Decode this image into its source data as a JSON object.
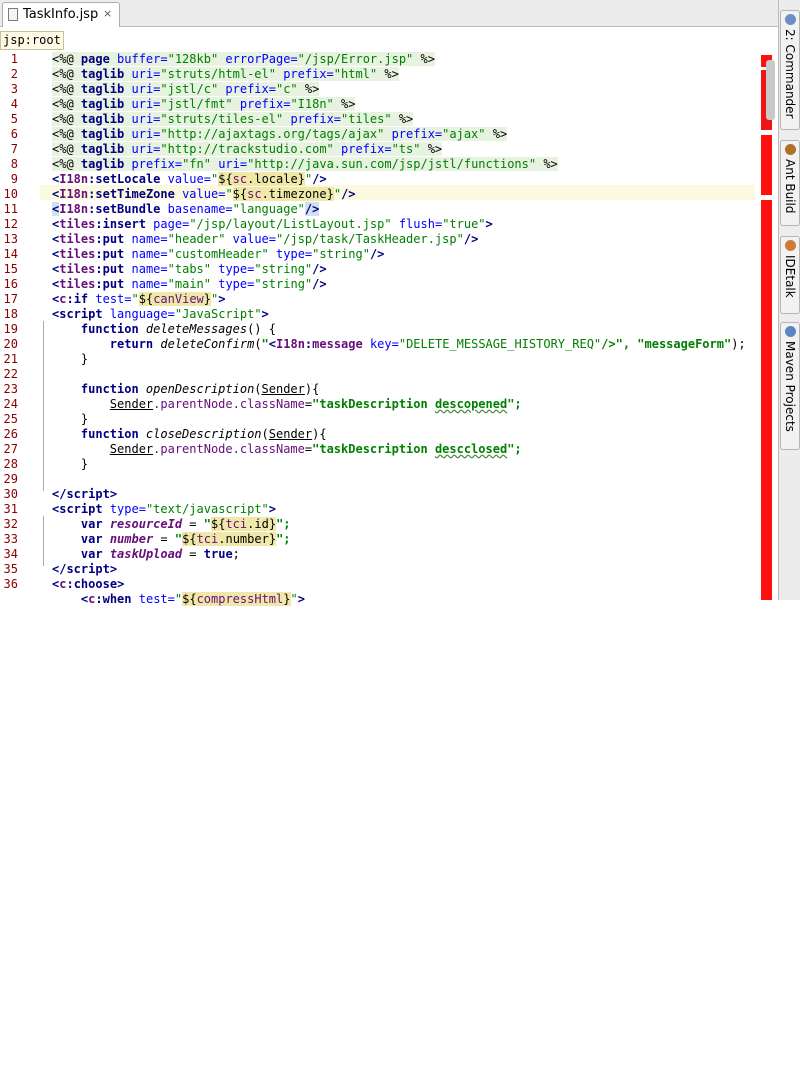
{
  "tab": {
    "title": "TaskInfo.jsp",
    "file_icon": "jsp-file-icon",
    "close_glyph": "×"
  },
  "breadcrumb": "jsp:root",
  "right_tools": [
    {
      "label": "2: Commander",
      "icon": "commander-icon"
    },
    {
      "label": "Ant Build",
      "icon": "ant-icon"
    },
    {
      "label": "IDEtalk",
      "icon": "idetalk-icon"
    },
    {
      "label": "Maven Projects",
      "icon": "maven-icon"
    }
  ],
  "line_numbers": [
    "1",
    "2",
    "3",
    "4",
    "5",
    "6",
    "7",
    "8",
    "9",
    "10",
    "11",
    "12",
    "13",
    "14",
    "15",
    "16",
    "17",
    "18",
    "19",
    "20",
    "21",
    "22",
    "23",
    "24",
    "25",
    "26",
    "27",
    "28",
    "29",
    "30",
    "31",
    "32",
    "33",
    "34",
    "35",
    "36"
  ],
  "tok": {
    "pd": "<%@ ",
    "page": "page",
    "taglib": "taglib",
    "pe": " %>",
    "buffer": " buffer=",
    "v128": "\"128kb\"",
    "errorPage": " errorPage=",
    "vError": "\"/jsp/Error.jsp\"",
    "uri": " uri=",
    "prefix": " prefix=",
    "v_struts_html": "\"struts/html-el\"",
    "v_html": "\"html\"",
    "v_jstl_c": "\"jstl/c\"",
    "v_c": "\"c\"",
    "v_jstl_fmt": "\"jstl/fmt\"",
    "v_i18n": "\"I18n\"",
    "v_struts_tiles": "\"struts/tiles-el\"",
    "v_tiles": "\"tiles\"",
    "v_ajax_url": "\"http://ajaxtags.org/tags/ajax\"",
    "v_ajax": "\"ajax\"",
    "v_ts_url": "\"http://trackstudio.com\"",
    "v_ts": "\"ts\"",
    "prefix_fn": "prefix=",
    "v_fn": "\"fn\"",
    "v_fn_url": "\"http://java.sun.com/jsp/jstl/functions\"",
    "lt": "<",
    "close": "/>",
    "gt": ">",
    "endopen": "</",
    "I18n": "I18n",
    "colon": ":",
    "setLocale": "setLocale",
    "setTimeZone": "setTimeZone",
    "setBundle": "setBundle",
    "value": " value=",
    "q_open": "\"",
    "el_open": "${",
    "sc": "sc",
    "dot_locale": ".locale",
    "dot_timezone": ".timezone",
    "el_close": "}",
    "q_close": "\"",
    "basename": " basename=",
    "v_language": "\"language\"",
    "tiles": "tiles",
    "insert": "insert",
    "put": "put",
    "page_attr": " page=",
    "v_listlayout": "\"/jsp/layout/ListLayout.jsp\"",
    "flush": " flush=",
    "v_true": "\"true\"",
    "name": " name=",
    "v_header": "\"header\"",
    "v_taskheader": "\"/jsp/task/TaskHeader.jsp\"",
    "v_customHeader": "\"customHeader\"",
    "type": " type=",
    "v_string": "\"string\"",
    "v_tabs": "\"tabs\"",
    "v_main": "\"main\"",
    "c": "c",
    "if": "if",
    "test": " test=",
    "canView": "canView",
    "script": "script",
    "language": " language=",
    "v_JavaScript": "\"JavaScript\"",
    "function": "function",
    "deleteMessages": " deleteMessages",
    "parens_open": "() {",
    "return": "return",
    "deleteConfirm": " deleteConfirm",
    "paren": "(",
    "dq": "\"",
    "message": "message",
    "key": " key=",
    "v_key": "\"DELETE_MESSAGE_HISTORY_REQ\"",
    "msg_tail": "/>\", ",
    "v_messageForm": "\"messageForm\"",
    "tail": ");",
    "rbrace": "}",
    "openDescription": " openDescription",
    "closeDescription": " closeDescription",
    "Sender": "Sender",
    "rparen_brace": "){",
    "parentNode": ".parentNode.",
    "className": "className",
    "eq": "=",
    "v_taskDescription": "\"taskDescription ",
    "descopened": "descopened",
    "descclosed": "descclosed",
    "q_semi": "\";",
    "v_text_js": "\"text/javascript\"",
    "var": "var",
    "resourceId": "resourceId",
    "number": "number",
    "taskUpload": "taskUpload",
    "assign": " = ",
    "tci": "tci",
    "dot_id": ".id",
    "dot_number": ".number",
    "q_semi2": "\";",
    "true_kw": "true",
    "semi": ";",
    "choose": "choose",
    "when": "when",
    "compressHtml": "compressHtml"
  }
}
